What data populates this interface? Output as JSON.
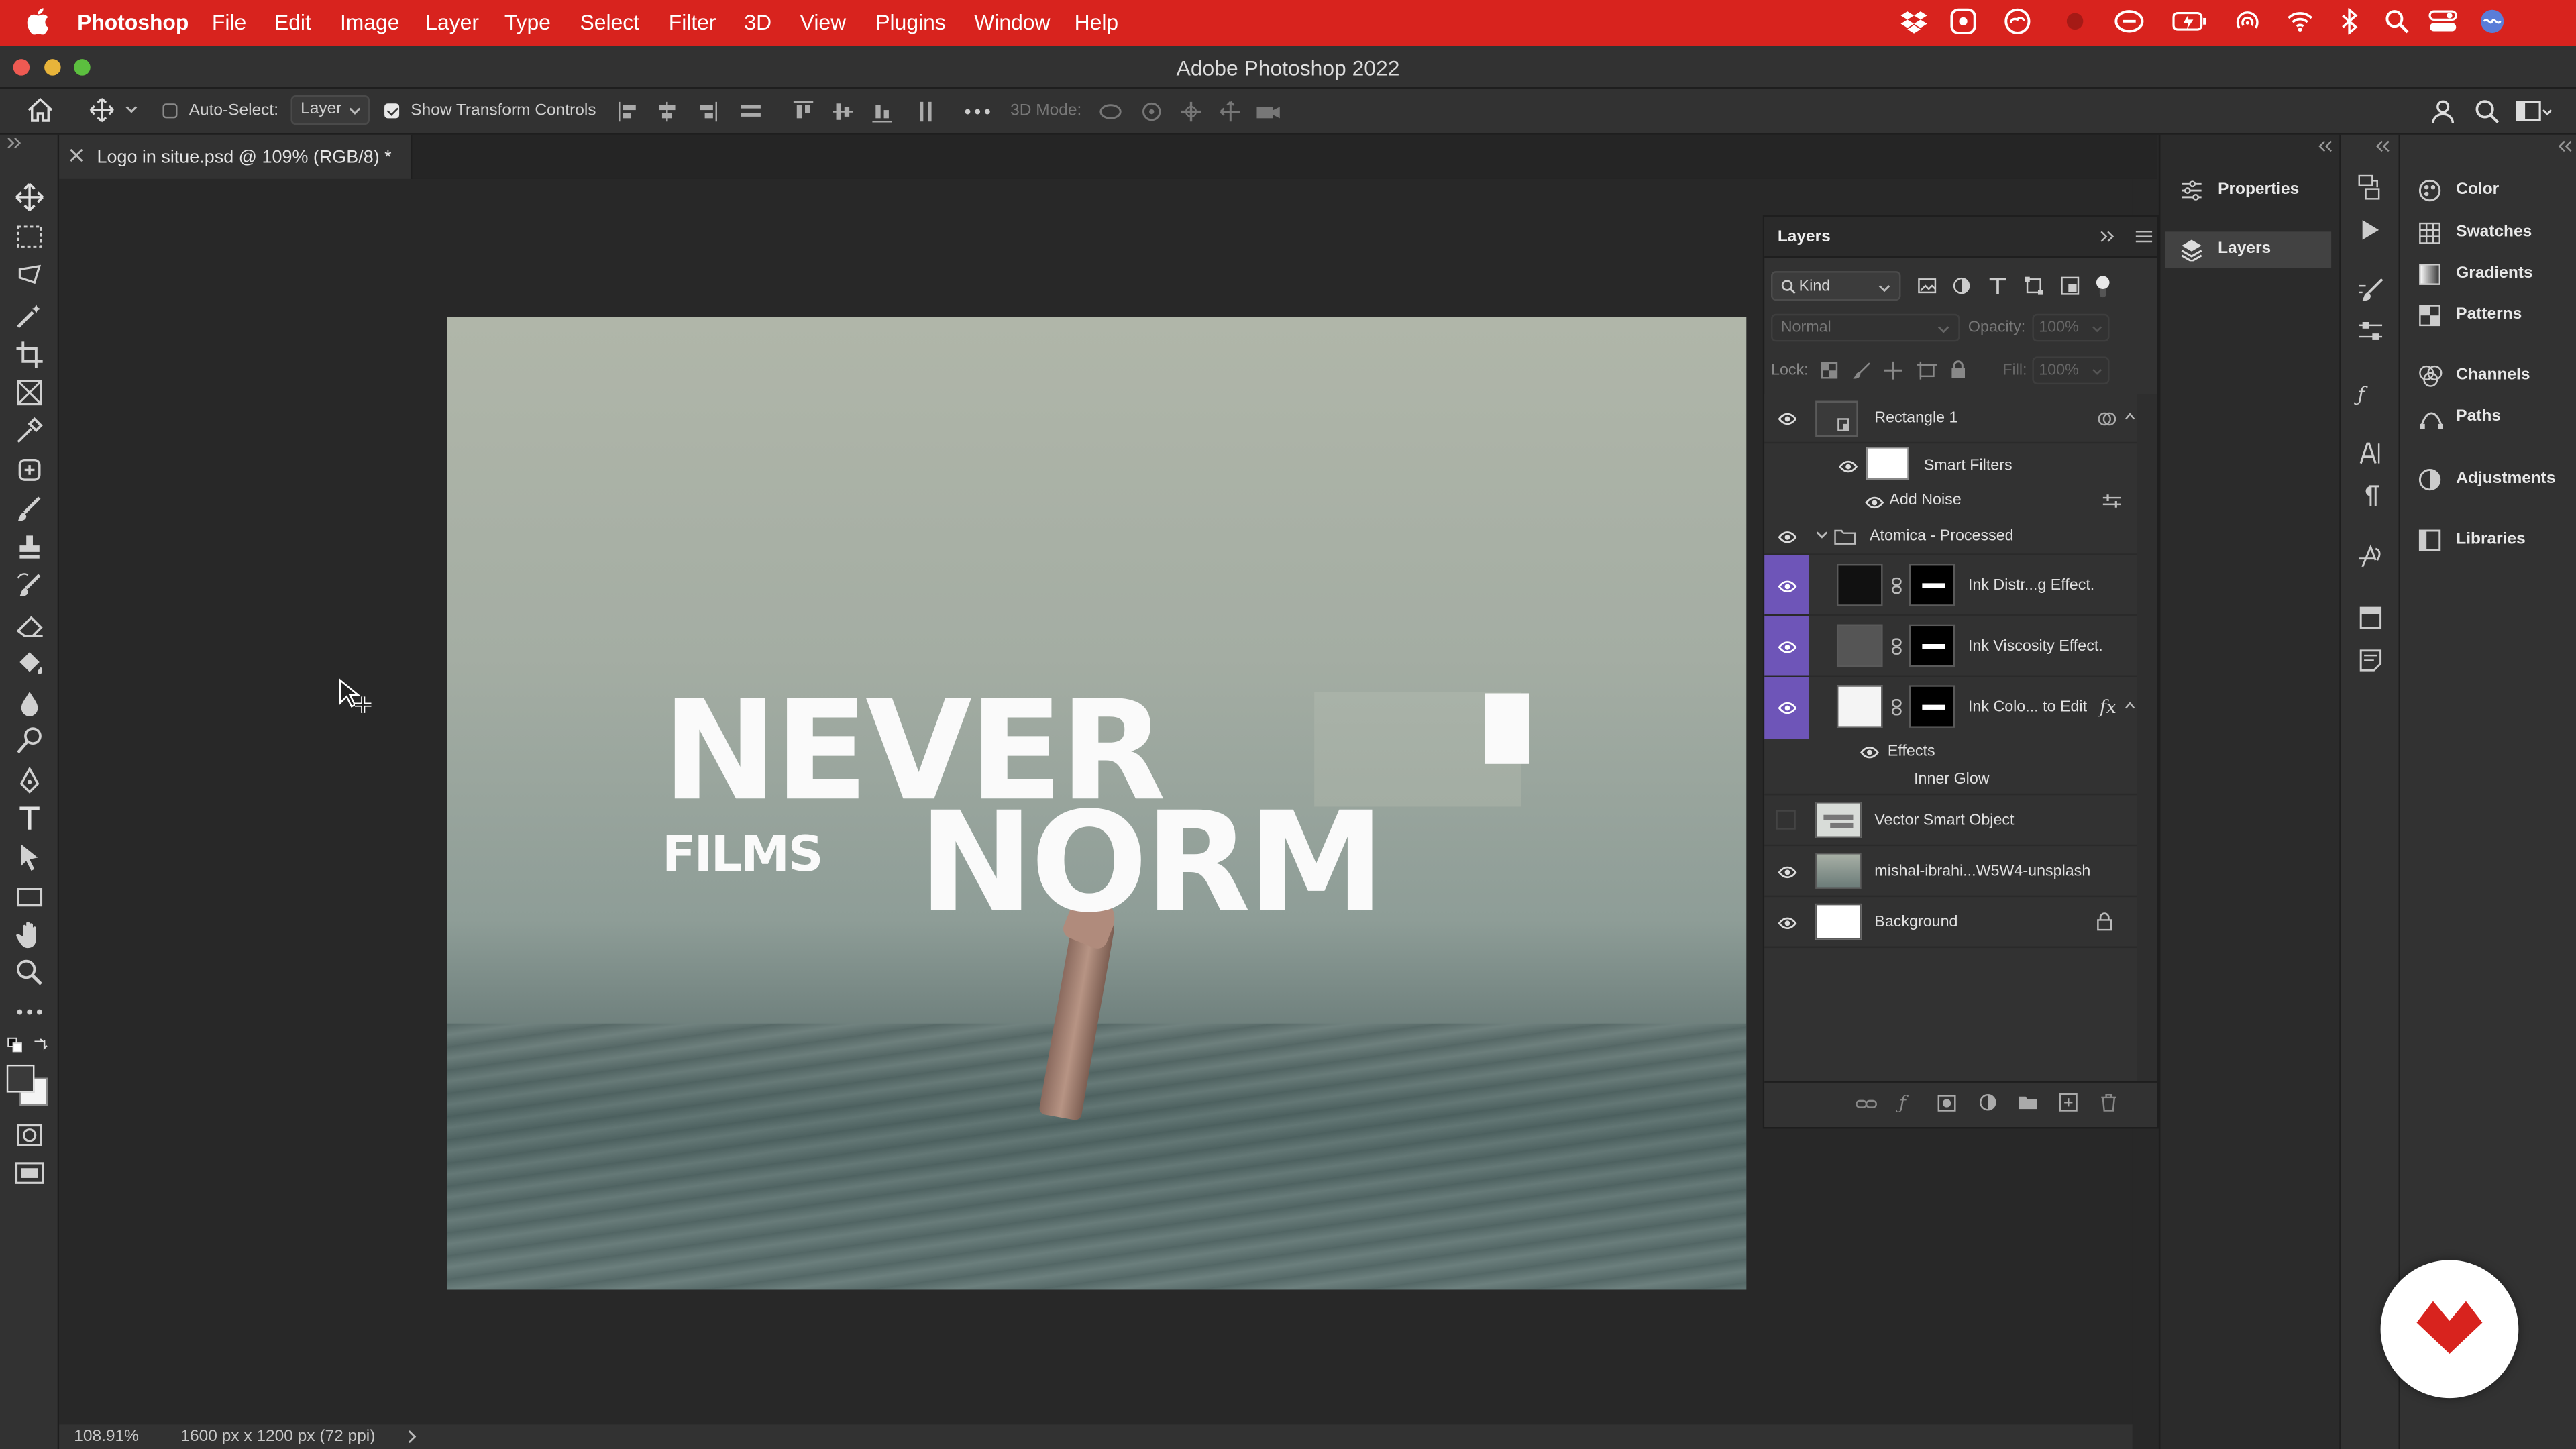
{
  "menubar": {
    "app_name": "Photoshop",
    "items": [
      "File",
      "Edit",
      "Image",
      "Layer",
      "Type",
      "Select",
      "Filter",
      "3D",
      "View",
      "Plugins",
      "Window",
      "Help"
    ]
  },
  "window": {
    "title": "Adobe Photoshop 2022"
  },
  "options_bar": {
    "auto_select_label": "Auto-Select:",
    "auto_select_checked": false,
    "auto_select_target": "Layer",
    "show_transform_label": "Show Transform Controls",
    "show_transform_checked": true,
    "mode_3d_label": "3D Mode:"
  },
  "document": {
    "tab_title": "Logo in situe.psd @ 109% (RGB/8) *",
    "zoom": "108.91%",
    "dimensions": "1600 px x 1200 px (72 ppi)"
  },
  "artwork": {
    "line1_word": "NEVER",
    "line2_small": "FILMS",
    "line2_word": "NORM"
  },
  "layers_panel": {
    "title": "Layers",
    "filter_kind": "Kind",
    "blend_mode": "Normal",
    "opacity_label": "Opacity:",
    "opacity_value": "100%",
    "lock_label": "Lock:",
    "fill_label": "Fill:",
    "fill_value": "100%",
    "rows": [
      {
        "name": "Rectangle 1",
        "visible": true
      },
      {
        "name": "Smart Filters",
        "visible": true
      },
      {
        "name": "Add Noise",
        "visible": true
      },
      {
        "name": "Atomica - Processed",
        "visible": true
      },
      {
        "name": "Ink Distr...g Effect.",
        "visible": true
      },
      {
        "name": "Ink Viscosity Effect.",
        "visible": true
      },
      {
        "name": "Ink Colo... to Edit",
        "visible": true,
        "fx": "fx"
      },
      {
        "name": "Effects",
        "visible": true
      },
      {
        "name": "Inner Glow",
        "visible": true
      },
      {
        "name": "Vector Smart Object",
        "visible": false
      },
      {
        "name": "mishal-ibrahi...W5W4-unsplash",
        "visible": true
      },
      {
        "name": "Background",
        "visible": true
      }
    ],
    "selected_color": "#6e55b8"
  },
  "dock_panels": {
    "group1": [
      "Properties",
      "Layers"
    ],
    "group2": [
      "Color",
      "Swatches",
      "Gradients",
      "Patterns",
      "Channels",
      "Paths",
      "Adjustments",
      "Libraries"
    ]
  },
  "colors": {
    "menubar": "#d8231e",
    "brand": "#d8231e"
  }
}
